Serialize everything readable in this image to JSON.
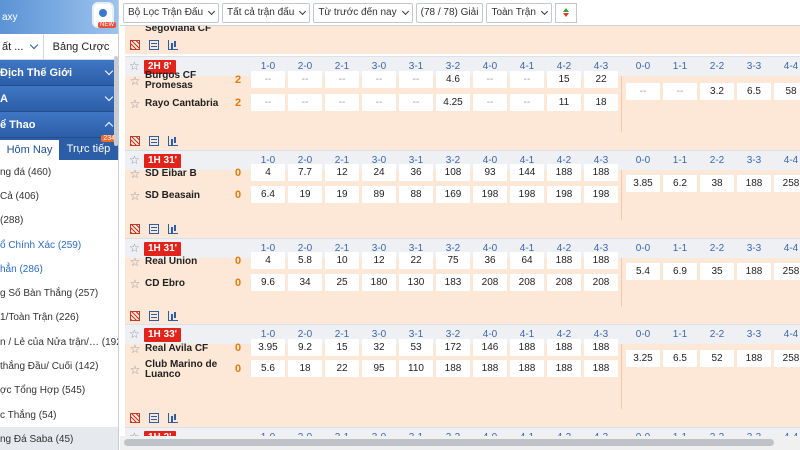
{
  "sidebar": {
    "brand": "axy",
    "brand_badge": "NEW",
    "select_a": "ất ...",
    "select_b": "Bảng Cược",
    "section1": "Địch Thế Giới",
    "section2": "A",
    "section3": "ể Thao",
    "tab_today": "Hôm Nay",
    "tab_live": "Trực tiếp",
    "tab_live_count": "234",
    "items": [
      "ng đá (460)",
      "Cả (406)",
      "(288)",
      "ổ Chính Xác (259)",
      "hẳn (286)",
      "g Số Bàn Thắng (257)",
      "1/Toàn Trận (226)",
      "n / Lẻ của Nửa trận/… (192)",
      "thắng Đầu/ Cuối (142)",
      "ợc Tổng Hợp (545)",
      "c Thắng (54)",
      "ng Đá Saba (45)"
    ]
  },
  "filters": {
    "league_filter": "Bộ Lọc Trận Đấu",
    "all_matches": "Tất cả trận đấu",
    "time_filter": "Từ trước đến nay",
    "count": "(78 / 78) Giải",
    "full_match": "Toàn Trận"
  },
  "columns": [
    "1-0",
    "2-0",
    "2-1",
    "3-0",
    "3-1",
    "3-2",
    "4-0",
    "4-1",
    "4-2",
    "4-3",
    "0-0",
    "1-1",
    "2-2",
    "3-3",
    "4-4"
  ],
  "top_partial_team": "Segoviana CF",
  "matches": [
    {
      "time": "2H 8'",
      "home": "Burgos CF Promesas",
      "away": "Rayo Cantabria",
      "home_score": "2",
      "away_score": "2",
      "home_odds": [
        "--",
        "--",
        "--",
        "--",
        "--",
        "4.6",
        "--",
        "--",
        "15",
        "22"
      ],
      "away_odds": [
        "--",
        "--",
        "--",
        "--",
        "--",
        "4.25",
        "--",
        "--",
        "11",
        "18"
      ],
      "draw_odds": [
        "--",
        "--",
        "3.2",
        "6.5",
        "58"
      ]
    },
    {
      "time": "1H 31'",
      "home": "SD Eibar B",
      "away": "SD Beasain",
      "home_score": "0",
      "away_score": "0",
      "home_odds": [
        "4",
        "7.7",
        "12",
        "24",
        "36",
        "108",
        "93",
        "144",
        "188",
        "188"
      ],
      "away_odds": [
        "6.4",
        "19",
        "19",
        "89",
        "88",
        "169",
        "198",
        "198",
        "198",
        "198"
      ],
      "draw_odds": [
        "3.85",
        "6.2",
        "38",
        "188",
        "258"
      ]
    },
    {
      "time": "1H 31'",
      "home": "Real Union",
      "away": "CD Ebro",
      "home_score": "0",
      "away_score": "0",
      "home_odds": [
        "4",
        "5.8",
        "10",
        "12",
        "22",
        "75",
        "36",
        "64",
        "188",
        "188"
      ],
      "away_odds": [
        "9.6",
        "34",
        "25",
        "180",
        "130",
        "183",
        "208",
        "208",
        "208",
        "208"
      ],
      "draw_odds": [
        "5.4",
        "6.9",
        "35",
        "188",
        "258"
      ]
    },
    {
      "time": "1H 33'",
      "home": "Real Avila CF",
      "away": "Club Marino de Luanco",
      "home_score": "0",
      "away_score": "0",
      "home_odds": [
        "3.95",
        "9.2",
        "15",
        "32",
        "53",
        "172",
        "146",
        "188",
        "188",
        "188"
      ],
      "away_odds": [
        "5.6",
        "18",
        "22",
        "95",
        "110",
        "188",
        "188",
        "188",
        "188",
        "188"
      ],
      "draw_odds": [
        "3.25",
        "6.5",
        "52",
        "188",
        "258"
      ]
    }
  ],
  "last_header_time": "1H 2'",
  "colors": {
    "accent": "#2c5ea8",
    "row_bg": "#fde7d6",
    "live_badge": "#e2231a",
    "score": "#e27a10"
  }
}
